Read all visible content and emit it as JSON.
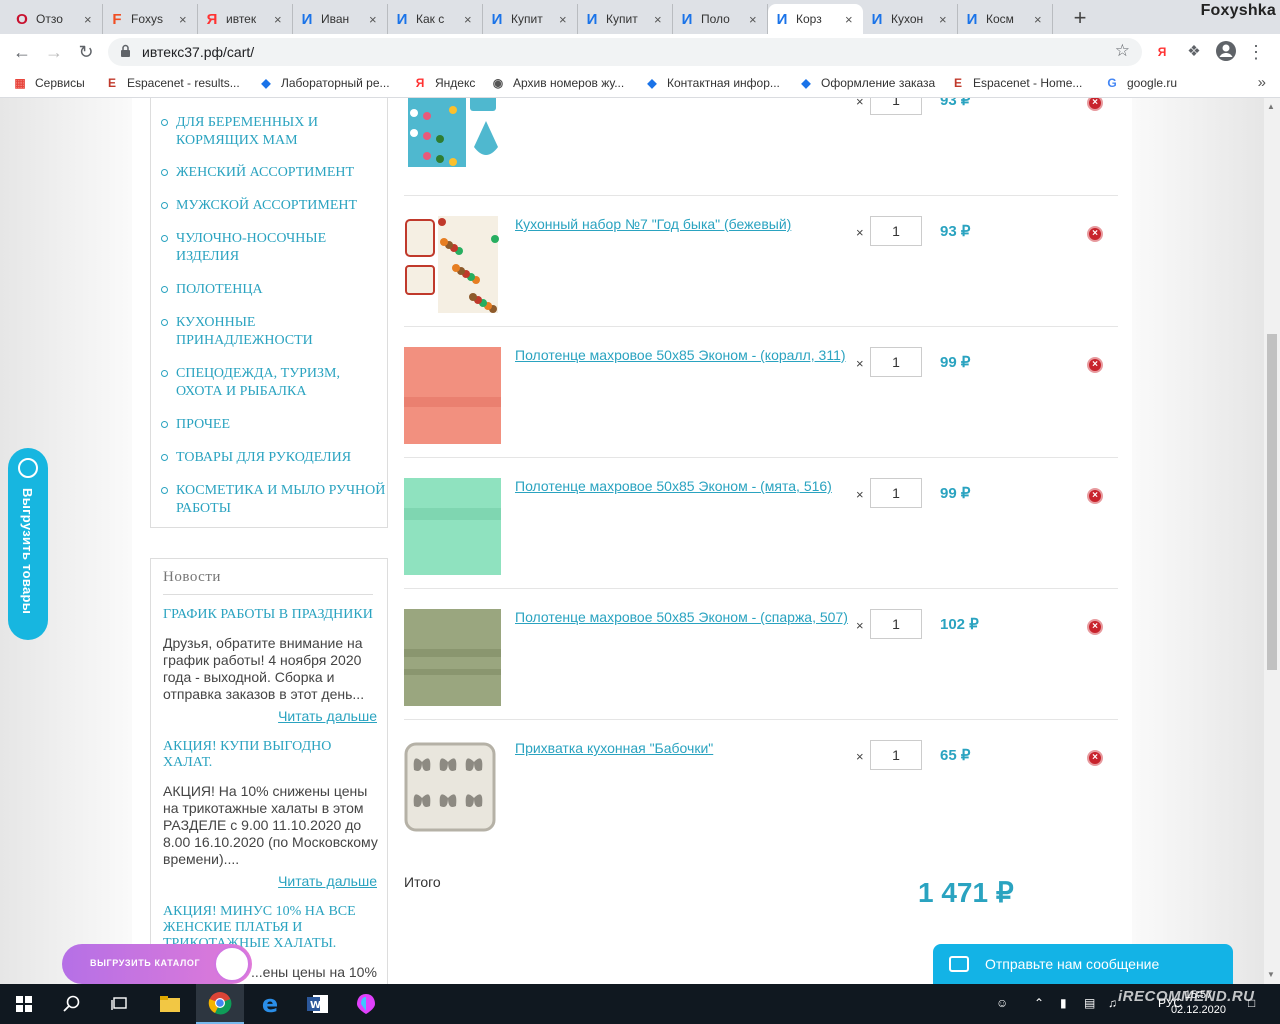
{
  "browser": {
    "window_title": "Foxyshka",
    "tabs": [
      {
        "label": "Отзо",
        "icon": "opera-icon",
        "color": "#c8102e",
        "glyph": "O"
      },
      {
        "label": "Foxys",
        "icon": "foxyshka-icon",
        "color": "#f04e23",
        "glyph": "F"
      },
      {
        "label": "ивтек",
        "icon": "yandex-icon",
        "color": "#f33",
        "glyph": "Я"
      },
      {
        "label": "Иван",
        "icon": "ivteks-icon",
        "color": "#1a73e8",
        "glyph": "И"
      },
      {
        "label": "Как с",
        "icon": "ivteks-icon",
        "color": "#1a73e8",
        "glyph": "И"
      },
      {
        "label": "Купит",
        "icon": "ivteks-icon",
        "color": "#1a73e8",
        "glyph": "И"
      },
      {
        "label": "Купит",
        "icon": "ivteks-icon",
        "color": "#1a73e8",
        "glyph": "И"
      },
      {
        "label": "Поло",
        "icon": "ivteks-icon",
        "color": "#1a73e8",
        "glyph": "И"
      },
      {
        "label": "Корз",
        "icon": "ivteks-icon",
        "color": "#1a73e8",
        "glyph": "И",
        "active": true
      },
      {
        "label": "Кухон",
        "icon": "ivteks-icon",
        "color": "#1a73e8",
        "glyph": "И"
      },
      {
        "label": "Косм",
        "icon": "ivteks-icon",
        "color": "#1a73e8",
        "glyph": "И"
      }
    ],
    "url": "ивтекс37.рф/cart/",
    "bookmarks": [
      {
        "label": "Сервисы",
        "icon": "apps-icon"
      },
      {
        "label": "Espacenet - results...",
        "icon": "espacenet-icon"
      },
      {
        "label": "Лабораторный ре...",
        "icon": "bookmark-icon"
      },
      {
        "label": "Яндекс",
        "icon": "yandex-icon"
      },
      {
        "label": "Архив номеров жу...",
        "icon": "globe-icon"
      },
      {
        "label": "Контактная инфор...",
        "icon": "bookmark-icon"
      },
      {
        "label": "Оформление заказа",
        "icon": "bookmark-icon"
      },
      {
        "label": "Espacenet - Home...",
        "icon": "espacenet-icon"
      },
      {
        "label": "google.ru",
        "icon": "google-icon"
      }
    ]
  },
  "sidebar": {
    "categories": [
      "Для беременных и кормящих мам",
      "Женский ассортимент",
      "Мужской ассортимент",
      "Чулочно-носочные изделия",
      "Полотенца",
      "Кухонные принадлежности",
      "Спецодежда, туризм, охота и рыбалка",
      "Прочее",
      "Товары для рукоделия",
      "Косметика и мыло ручной работы"
    ],
    "news_heading": "Новости",
    "news": [
      {
        "title": "График работы в праздники",
        "text": "Друзья, обратите внимание на график работы! 4 ноября 2020 года - выходной. Сборка и отправка заказов в этот день...",
        "more": "Читать дальше"
      },
      {
        "title": "Акция! Купи выгодно халат.",
        "text": "АКЦИЯ! На 10% снижены цены на  трикотажные халаты в этом РАЗДЕЛЕ с 9.00 11.10.2020 до 8.00 16.10.2020 (по Московскому времени)....",
        "more": "Читать дальше"
      },
      {
        "title": "Акция! Минус 10% на все женские платья и трикотажные халаты.",
        "text": "...ены цены на 10%"
      }
    ]
  },
  "cart": {
    "items": [
      {
        "name": "",
        "qty": "1",
        "price": "93 ₽",
        "thumb": "kitchen-set-blue"
      },
      {
        "name": "Кухонный набор №7 \"Год быка\" (бежевый)",
        "qty": "1",
        "price": "93 ₽",
        "thumb": "kitchen-set-beige"
      },
      {
        "name": "Полотенце махровое 50х85 Эконом - (коралл, 311)",
        "qty": "1",
        "price": "99 ₽",
        "thumb": "towel-coral"
      },
      {
        "name": "Полотенце махровое 50х85 Эконом - (мята, 516)",
        "qty": "1",
        "price": "99 ₽",
        "thumb": "towel-mint"
      },
      {
        "name": "Полотенце махровое 50х85 Эконом - (спаржа, 507)",
        "qty": "1",
        "price": "102 ₽",
        "thumb": "towel-asparagus"
      },
      {
        "name": "Прихватка кухонная \"Бабочки\"",
        "qty": "1",
        "price": "65 ₽",
        "thumb": "potholder-butterflies"
      }
    ],
    "times_sign": "×",
    "remove_glyph": "×",
    "total_label": "Итого",
    "total_value": "1 471 ₽"
  },
  "widgets": {
    "export_goods": "Выгрузить товары",
    "export_catalog": "Выгрузить каталог",
    "chat": "Отправьте нам сообщение"
  },
  "taskbar": {
    "lang": "РУС",
    "time": "15:57",
    "date": "02.12.2020"
  },
  "watermark": "iRECOMMEND.RU",
  "colors": {
    "accent": "#2aa3c0",
    "remove": "#c8232c",
    "widget_blue": "#13b3e6"
  }
}
